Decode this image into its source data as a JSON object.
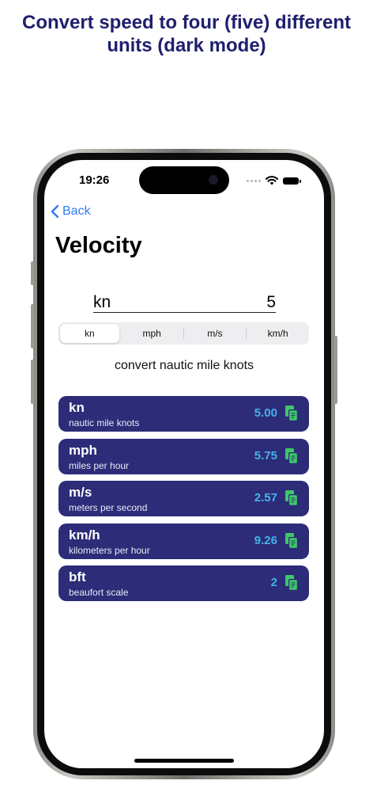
{
  "headline": "Convert speed to four (five) different units (dark mode)",
  "status": {
    "time": "19:26"
  },
  "nav": {
    "back_label": "Back"
  },
  "page": {
    "title": "Velocity"
  },
  "input": {
    "unit": "kn",
    "value": "5"
  },
  "segments": {
    "items": [
      "kn",
      "mph",
      "m/s",
      "km/h"
    ],
    "selected": "kn"
  },
  "convert_label": "convert nautic mile knots",
  "results": [
    {
      "unit": "kn",
      "desc": "nautic mile knots",
      "value": "5.00"
    },
    {
      "unit": "mph",
      "desc": "miles per hour",
      "value": "5.75"
    },
    {
      "unit": "m/s",
      "desc": "meters per second",
      "value": "2.57"
    },
    {
      "unit": "km/h",
      "desc": "kilometers per hour",
      "value": "9.26"
    },
    {
      "unit": "bft",
      "desc": "beaufort scale",
      "value": "2"
    }
  ],
  "colors": {
    "headline": "#1f1f6e",
    "card_bg": "#2c2c78",
    "value_text": "#45b3e6",
    "copy_icon": "#3fc76a",
    "link": "#2f7cf6"
  },
  "icons": {
    "back": "chevron-left-icon",
    "copy": "copy-icon",
    "wifi": "wifi-icon",
    "battery": "battery-icon"
  }
}
